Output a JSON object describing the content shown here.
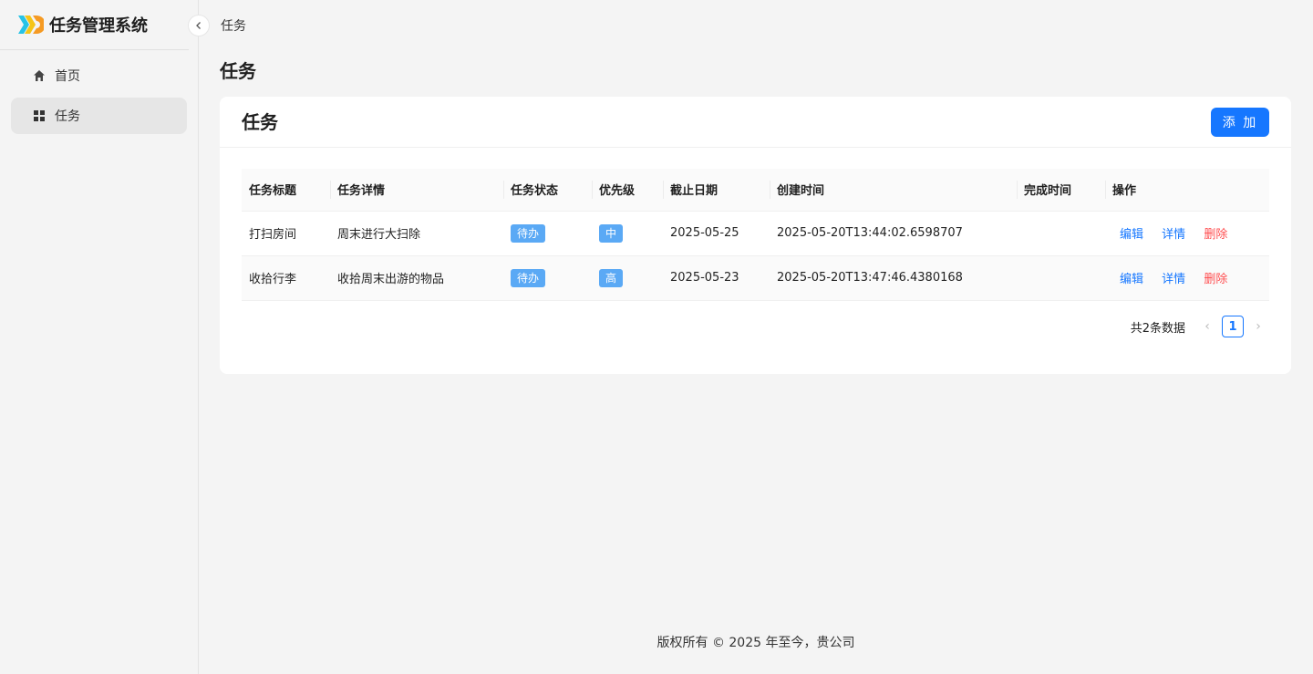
{
  "app": {
    "title": "任务管理系统"
  },
  "sidebar": {
    "collapse_icon": "chevron-left-icon",
    "items": [
      {
        "label": "首页",
        "icon": "home-icon",
        "active": false
      },
      {
        "label": "任务",
        "icon": "grid-icon",
        "active": true
      }
    ]
  },
  "breadcrumb": "任务",
  "page_title": "任务",
  "card": {
    "title": "任务",
    "add_label": "添 加"
  },
  "table": {
    "headers": [
      "任务标题",
      "任务详情",
      "任务状态",
      "优先级",
      "截止日期",
      "创建时间",
      "完成时间",
      "操作"
    ],
    "rows": [
      {
        "title": "打扫房间",
        "detail": "周末进行大扫除",
        "status": "待办",
        "priority": "中",
        "deadline": "2025-05-25",
        "created": "2025-05-20T13:44:02.6598707",
        "completed": "",
        "edit": "编辑",
        "view": "详情",
        "delete": "删除"
      },
      {
        "title": "收拾行李",
        "detail": "收拾周末出游的物品",
        "status": "待办",
        "priority": "高",
        "deadline": "2025-05-23",
        "created": "2025-05-20T13:47:46.4380168",
        "completed": "",
        "edit": "编辑",
        "view": "详情",
        "delete": "删除"
      }
    ]
  },
  "pagination": {
    "total_text": "共2条数据",
    "current": "1"
  },
  "footer": "版权所有 © 2025 年至今，贵公司",
  "colors": {
    "primary": "#1677ff",
    "danger": "#ff4d4f",
    "tag": "#5aa9f5"
  }
}
